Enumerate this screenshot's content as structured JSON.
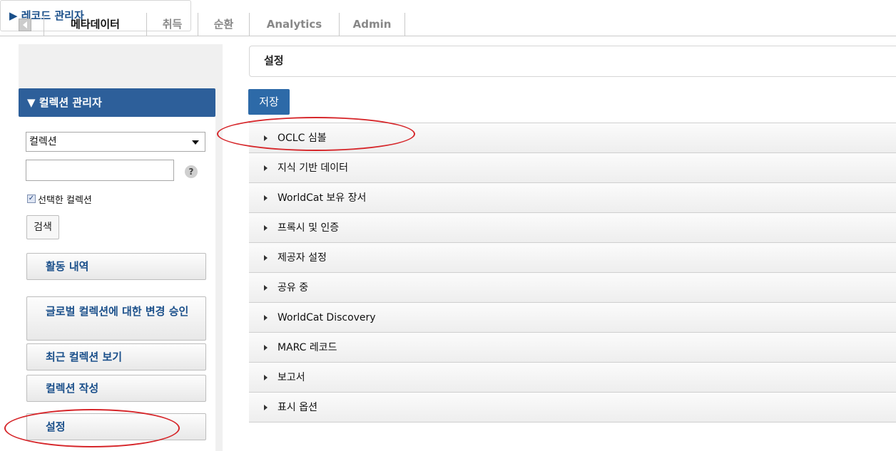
{
  "tabs": [
    {
      "label": "메타데이터",
      "active": true
    },
    {
      "label": "취득",
      "active": false
    },
    {
      "label": "순환",
      "active": false
    },
    {
      "label": "Analytics",
      "active": false
    },
    {
      "label": "Admin",
      "active": false
    }
  ],
  "sidebar": {
    "record_manager": "▶ 레코드 관리자",
    "collection_manager": "▼ 컬렉션 관리자",
    "select_value": "컬렉션",
    "search_value": "",
    "help_label": "?",
    "checkbox_checked": true,
    "checkbox_mark": "✓",
    "checkbox_label": "선택한 컬렉션",
    "search_button": "검색",
    "buttons": [
      "활동 내역",
      "글로벌 컬렉션에 대한 변경 승인",
      "최근 컬렉션 보기",
      "컬렉션 작성",
      "설정"
    ]
  },
  "main": {
    "title": "설정",
    "save_button": "저장",
    "sections": [
      "OCLC 심볼",
      "지식 기반 데이터",
      "WorldCat 보유 장서",
      "프록시 및 인증",
      "제공자 설정",
      "공유 중",
      "WorldCat Discovery",
      "MARC 레코드",
      "보고서",
      "표시 옵션"
    ]
  },
  "colors": {
    "accent": "#2d5f9a",
    "link": "#1a4f8a",
    "annotation": "#d6262a"
  }
}
